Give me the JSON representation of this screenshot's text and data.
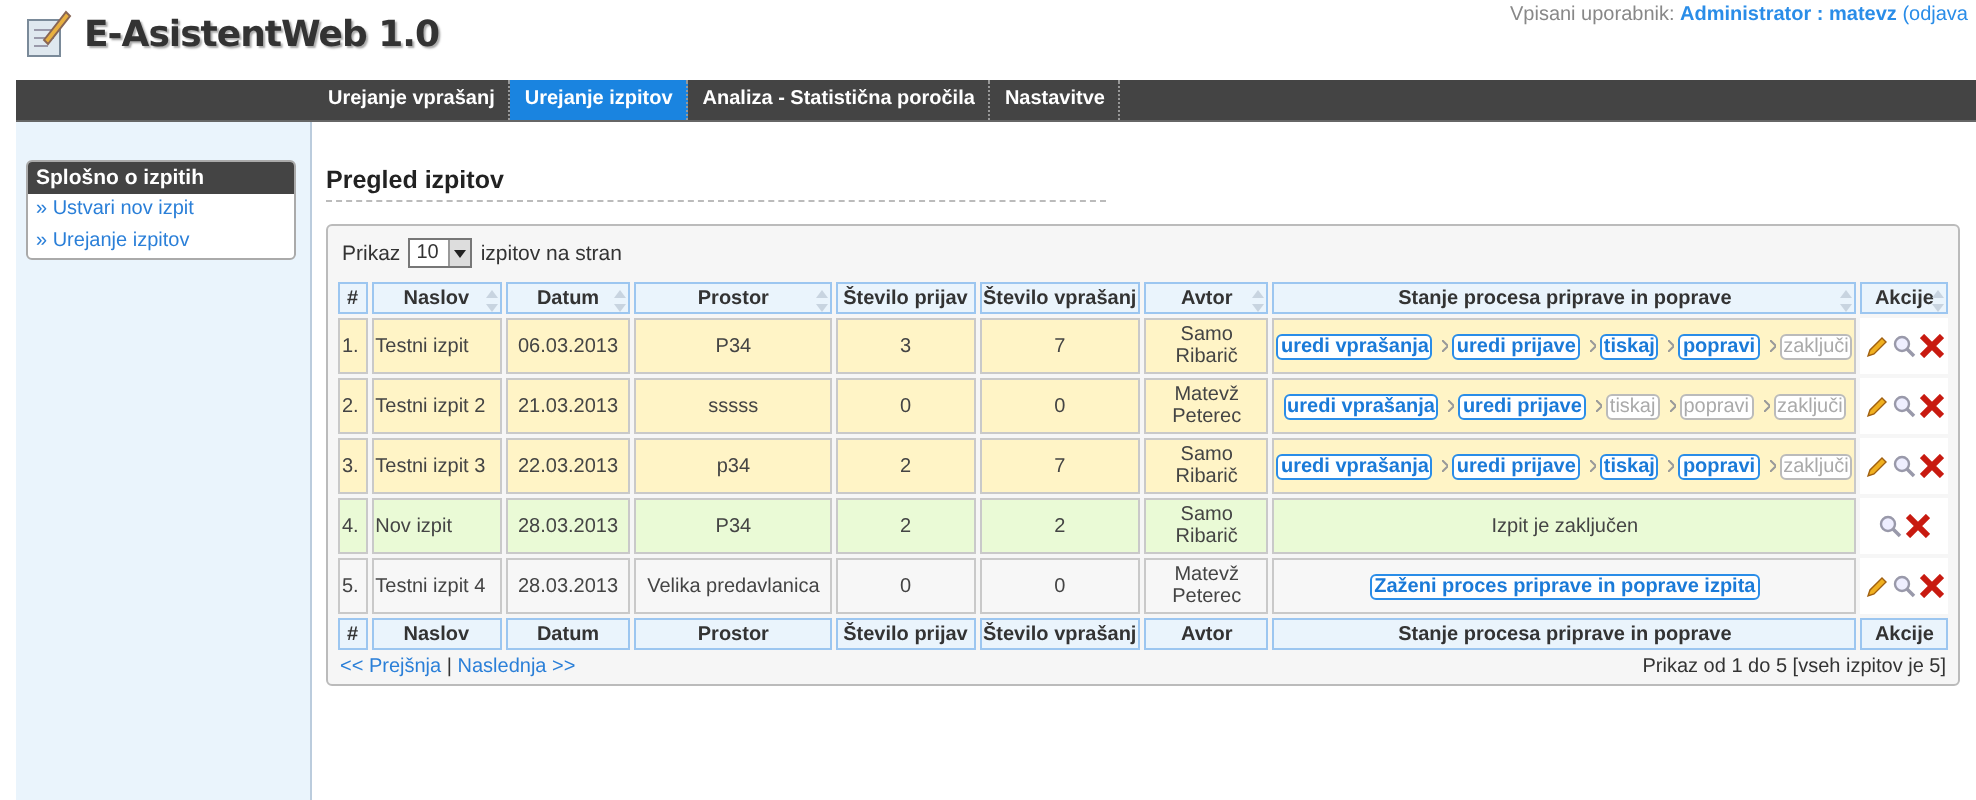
{
  "header": {
    "title": "E-AsistentWeb 1.0",
    "user_label": "Vpisani uporabnik:",
    "user": "Administrator : matevz",
    "logout": "(odjava"
  },
  "nav": [
    {
      "label": "Urejanje vprašanj",
      "selected": false
    },
    {
      "label": "Urejanje izpitov",
      "selected": true
    },
    {
      "label": "Analiza - Statistična poročila",
      "selected": false
    },
    {
      "label": "Nastavitve",
      "selected": false
    }
  ],
  "sidebar": {
    "title": "Splošno o izpitih",
    "items": [
      "» Ustvari nov izpit",
      "» Urejanje izpitov"
    ]
  },
  "page_title": "Pregled izpitov",
  "page_size": {
    "before": "Prikaz",
    "value": "10",
    "after": "izpitov na stran"
  },
  "table": {
    "columns": [
      {
        "label": "#",
        "sortable": false
      },
      {
        "label": "Naslov",
        "sortable": true
      },
      {
        "label": "Datum",
        "sortable": true
      },
      {
        "label": "Prostor",
        "sortable": true
      },
      {
        "label": "Število prijav",
        "sortable": false
      },
      {
        "label": "Število vprašanj",
        "sortable": false
      },
      {
        "label": "Avtor",
        "sortable": true
      },
      {
        "label": "Stanje procesa priprave in poprave",
        "sortable": true
      },
      {
        "label": "Akcije",
        "sortable": true
      }
    ],
    "rows": [
      {
        "color": "#fff4c6",
        "cells": [
          "1.",
          "Testni izpit",
          "06.03.2013",
          "P34",
          "3",
          "7",
          "Samo Ribarič"
        ],
        "status": {
          "kind": "steps",
          "steps": [
            {
              "label": "uredi vprašanja",
              "enabled": true
            },
            {
              "label": "uredi prijave",
              "enabled": true
            },
            {
              "label": "tiskaj",
              "enabled": true
            },
            {
              "label": "popravi",
              "enabled": true
            },
            {
              "label": "zaključi",
              "enabled": false
            }
          ]
        },
        "actions": [
          {
            "kind": "edit"
          },
          {
            "kind": "view"
          },
          {
            "kind": "delete"
          }
        ]
      },
      {
        "color": "#fff4c6",
        "cells": [
          "2.",
          "Testni izpit 2",
          "21.03.2013",
          "sssss",
          "0",
          "0",
          "Matevž Peterec"
        ],
        "status": {
          "kind": "steps",
          "steps": [
            {
              "label": "uredi vprašanja",
              "enabled": true
            },
            {
              "label": "uredi prijave",
              "enabled": true
            },
            {
              "label": "tiskaj",
              "enabled": false
            },
            {
              "label": "popravi",
              "enabled": false
            },
            {
              "label": "zaključi",
              "enabled": false
            }
          ]
        },
        "actions": [
          {
            "kind": "edit"
          },
          {
            "kind": "view"
          },
          {
            "kind": "delete"
          }
        ]
      },
      {
        "color": "#fff4c6",
        "cells": [
          "3.",
          "Testni izpit 3",
          "22.03.2013",
          "p34",
          "2",
          "7",
          "Samo Ribarič"
        ],
        "status": {
          "kind": "steps",
          "steps": [
            {
              "label": "uredi vprašanja",
              "enabled": true
            },
            {
              "label": "uredi prijave",
              "enabled": true
            },
            {
              "label": "tiskaj",
              "enabled": true
            },
            {
              "label": "popravi",
              "enabled": true
            },
            {
              "label": "zaključi",
              "enabled": false
            }
          ]
        },
        "actions": [
          {
            "kind": "edit"
          },
          {
            "kind": "view"
          },
          {
            "kind": "delete"
          }
        ]
      },
      {
        "color": "#eafad6",
        "cells": [
          "4.",
          "Nov izpit",
          "28.03.2013",
          "P34",
          "2",
          "2",
          "Samo Ribarič"
        ],
        "status": {
          "kind": "text",
          "text": "Izpit je zaključen"
        },
        "actions": [
          {
            "kind": "view"
          },
          {
            "kind": "delete"
          }
        ]
      },
      {
        "color": "#f7f7f7",
        "cells": [
          "5.",
          "Testni izpit 4",
          "28.03.2013",
          "Velika predavlanica",
          "0",
          "0",
          "Matevž Peterec"
        ],
        "status": {
          "kind": "start",
          "text": "Zaženi proces priprave in poprave izpita"
        },
        "actions": [
          {
            "kind": "edit"
          },
          {
            "kind": "view"
          },
          {
            "kind": "delete"
          }
        ]
      }
    ],
    "footer": [
      "#",
      "Naslov",
      "Datum",
      "Prostor",
      "Število prijav",
      "Število vprašanj",
      "Avtor",
      "Stanje procesa priprave in poprave",
      "Akcije"
    ]
  },
  "pager": {
    "prev": "<< Prejšnja",
    "separator": "|",
    "next": "Naslednja >>",
    "info": "Prikaz od 1 do 5 [vseh izpitov je 5]"
  }
}
